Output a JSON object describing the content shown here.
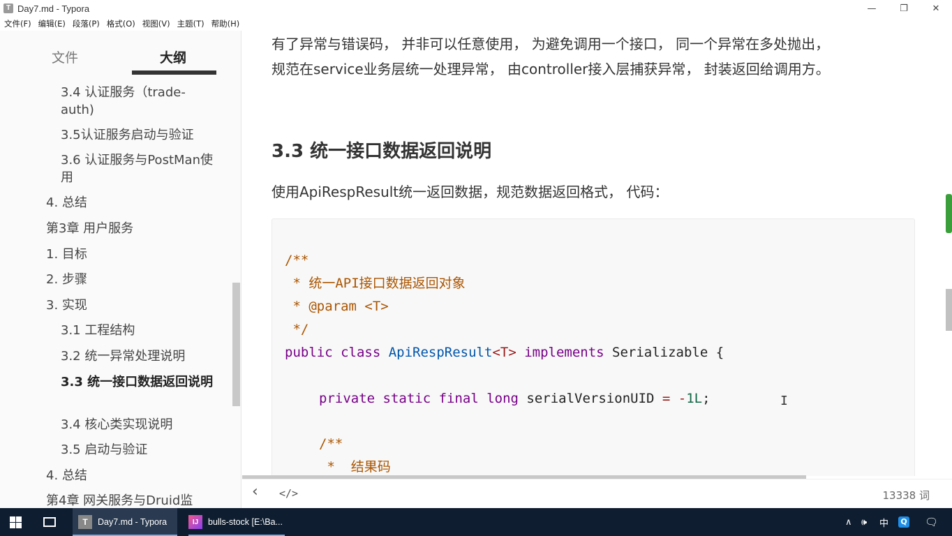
{
  "window": {
    "icon_letter": "T",
    "title": "Day7.md - Typora",
    "minimize": "—",
    "restore": "❐",
    "close": "✕"
  },
  "menu": [
    "文件(F)",
    "编辑(E)",
    "段落(P)",
    "格式(O)",
    "视图(V)",
    "主题(T)",
    "帮助(H)"
  ],
  "sidebar": {
    "tabs": [
      "文件",
      "大纲"
    ],
    "outline": [
      "3.4 认证服务（trade-auth)",
      "3.5认证服务启动与验证",
      "3.6 认证服务与PostMan使用",
      "4. 总结",
      "第3章 用户服务",
      "1. 目标",
      "2. 步骤",
      "3. 实现",
      "3.1 工程结构",
      "3.2 统一异常处理说明",
      "3.3 统一接口数据返回说明",
      "3.4 核心类实现说明",
      "3.5 启动与验证",
      "4. 总结",
      "第4章 网关服务与Druid监"
    ]
  },
  "editor": {
    "para1_line1": "有了异常与错误码， 并非可以任意使用， 为避免调用一个接口， 同一个异常在多处抛出，",
    "para1_line2": "规范在service业务层统一处理异常， 由controller接入层捕获异常， 封装返回给调用方。",
    "heading": "3.3 统一接口数据返回说明",
    "para2": "使用ApiRespResult统一返回数据，规范数据返回格式， 代码：",
    "code": {
      "l1": "/**",
      "l2": " * 统一API接口数据返回对象",
      "l3": " * @param <T>",
      "l4": " */",
      "l5_kw": "public class ",
      "l5_type": "ApiRespResult",
      "l5_generic": "<T>",
      "l5_impl": " implements ",
      "l5_rest": "Serializable {",
      "l6_kw": "private static final long ",
      "l6_name": "serialVersionUID ",
      "l6_eq": "= -",
      "l6_num": "1L",
      "l6_end": ";",
      "l7": "/**",
      "l8": " *  结果码"
    }
  },
  "footer": {
    "back": "‹",
    "source": "</>",
    "word_count": "13338 词"
  },
  "taskbar": {
    "tasks": [
      {
        "icon": "T",
        "label": "Day7.md - Typora"
      },
      {
        "icon": "IJ",
        "label": "bulls-stock [E:\\Ba..."
      }
    ],
    "tray": {
      "chevron": "∧",
      "volume": "🕪",
      "ime": "中",
      "qq": "Q",
      "notify": "🗨"
    }
  }
}
